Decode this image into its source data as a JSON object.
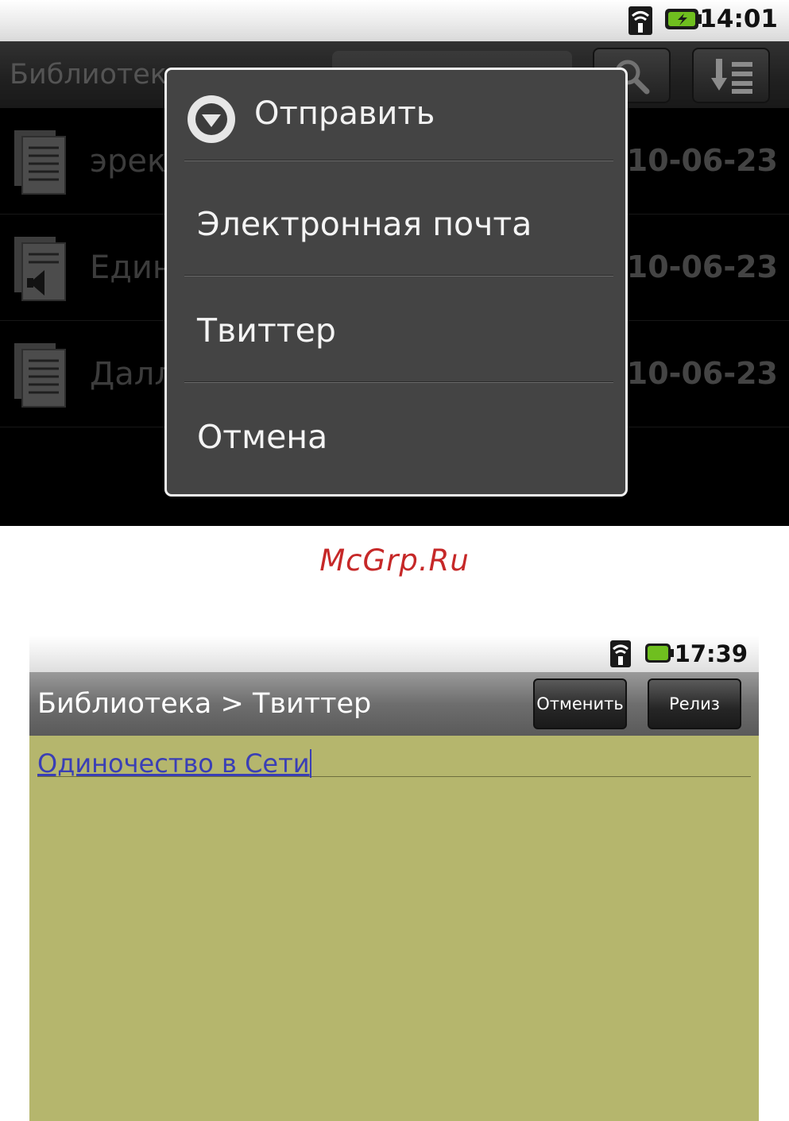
{
  "screen1": {
    "statusbar": {
      "time": "14:01",
      "wifi_icon": "wifi-icon",
      "battery_icon": "battery-charging-icon"
    },
    "toolbar": {
      "title": "Библиотек",
      "search_icon": "search-icon",
      "sort_icon": "sort-icon"
    },
    "list": [
      {
        "name": "эрекция",
        "date": "2010-06-23",
        "icon": "document-icon"
      },
      {
        "name": "Единственн...",
        "date": "2010-06-23",
        "icon": "audio-document-icon"
      },
      {
        "name": "Далласе. Е...",
        "date": "2010-06-23",
        "icon": "document-icon"
      }
    ],
    "dialog": {
      "title": "Отправить",
      "icon": "dropdown-arrow-icon",
      "items": [
        "Электронная почта",
        "Твиттер",
        "Отмена"
      ]
    }
  },
  "watermark": "McGrp.Ru",
  "screen2": {
    "statusbar": {
      "time": "17:39",
      "wifi_icon": "wifi-icon",
      "battery_icon": "battery-icon"
    },
    "toolbar": {
      "title": "Библиотека > Твиттер",
      "cancel_label": "Отменить",
      "release_label": "Релиз"
    },
    "editor": {
      "text": "Одиночество в Сети"
    }
  },
  "colors": {
    "dialog_bg": "#444444",
    "editor_bg": "#b5b66d",
    "link_text": "#3a3fb5",
    "watermark": "#c62828",
    "battery_green": "#6fbf1f"
  }
}
